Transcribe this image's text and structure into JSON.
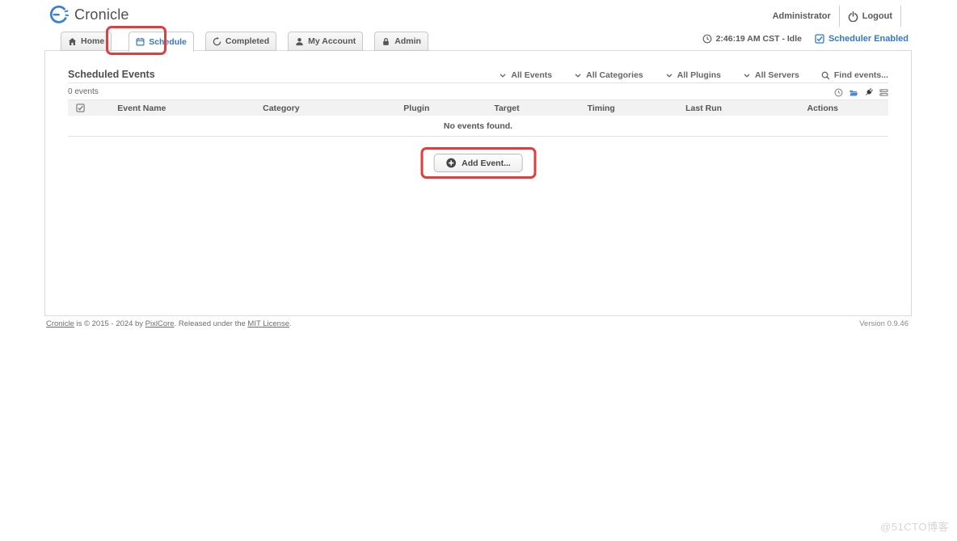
{
  "app": {
    "name": "Cronicle",
    "version": "Version 0.9.46"
  },
  "header": {
    "username": "Administrator",
    "logout_label": "Logout"
  },
  "status": {
    "time_text": "2:46:19 AM CST - Idle",
    "scheduler_text": "Scheduler Enabled"
  },
  "tabs": [
    {
      "label": "Home"
    },
    {
      "label": "Schedule"
    },
    {
      "label": "Completed"
    },
    {
      "label": "My Account"
    },
    {
      "label": "Admin"
    }
  ],
  "panel": {
    "title": "Scheduled Events",
    "filters": [
      {
        "label": "All Events"
      },
      {
        "label": "All Categories"
      },
      {
        "label": "All Plugins"
      },
      {
        "label": "All Servers"
      }
    ],
    "search_label": "Find events...",
    "count_label": "0 events",
    "columns": [
      "Event Name",
      "Category",
      "Plugin",
      "Target",
      "Timing",
      "Last Run",
      "Actions"
    ],
    "empty_message": "No events found.",
    "add_button_label": "Add Event..."
  },
  "footer": {
    "link_cronicle": "Cronicle",
    "mid1": " is © 2015 - 2024 by ",
    "link_pixlcore": "PixlCore",
    "mid2": ". Released under the ",
    "link_mit": "MIT License",
    "end": "."
  },
  "watermark": "@51CTO博客",
  "icons": {
    "logo": "clock-logo",
    "tabs": [
      "home-icon",
      "calendar-icon",
      "history-icon",
      "user-icon",
      "lock-icon"
    ],
    "logout": "power-icon",
    "status": [
      "clock-icon",
      "checkbox-checked-icon"
    ],
    "filters": "chevron-down-icon",
    "search": "search-icon",
    "toolbar": [
      "clock-icon",
      "folder-icon",
      "plug-icon",
      "servers-icon"
    ],
    "table_select": "checkbox-checked-icon",
    "add_event": "plus-circle-icon"
  },
  "colors": {
    "accent_blue": "#3277c9",
    "annotation_red": "#e23d3d",
    "text_dark": "#555555",
    "panel_border": "#d9d9d9",
    "folder_blue": "#4a86d8",
    "table_head_bg": "#f2f2f2"
  }
}
